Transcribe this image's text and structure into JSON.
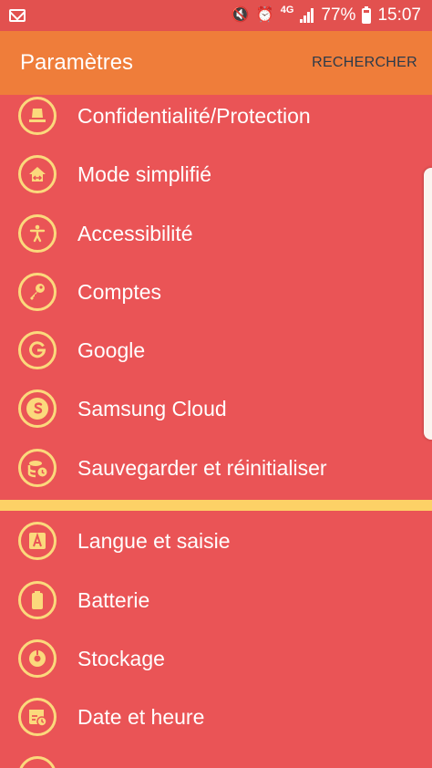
{
  "status_bar": {
    "network": "4G",
    "battery_percent": "77%",
    "time": "15:07"
  },
  "app_bar": {
    "title": "Paramètres",
    "search_label": "RECHERCHER"
  },
  "settings_items": [
    {
      "label": "Confidentialité/Protection",
      "icon": "privacy-icon"
    },
    {
      "label": "Mode simplifié",
      "icon": "easy-mode-icon"
    },
    {
      "label": "Accessibilité",
      "icon": "accessibility-icon"
    },
    {
      "label": "Comptes",
      "icon": "accounts-key-icon"
    },
    {
      "label": "Google",
      "icon": "google-icon"
    },
    {
      "label": "Samsung Cloud",
      "icon": "samsung-cloud-icon"
    },
    {
      "label": "Sauvegarder et réinitialiser",
      "icon": "backup-reset-icon"
    },
    {
      "label": "Langue et saisie",
      "icon": "language-input-icon"
    },
    {
      "label": "Batterie",
      "icon": "battery-icon"
    },
    {
      "label": "Stockage",
      "icon": "storage-icon"
    },
    {
      "label": "Date et heure",
      "icon": "date-time-icon"
    },
    {
      "label": "",
      "icon": "partial-item-icon"
    }
  ],
  "colors": {
    "background": "#ea5456",
    "app_bar": "#ef7d3a",
    "icon_accent": "#fbd97c",
    "divider": "#fdd166"
  }
}
